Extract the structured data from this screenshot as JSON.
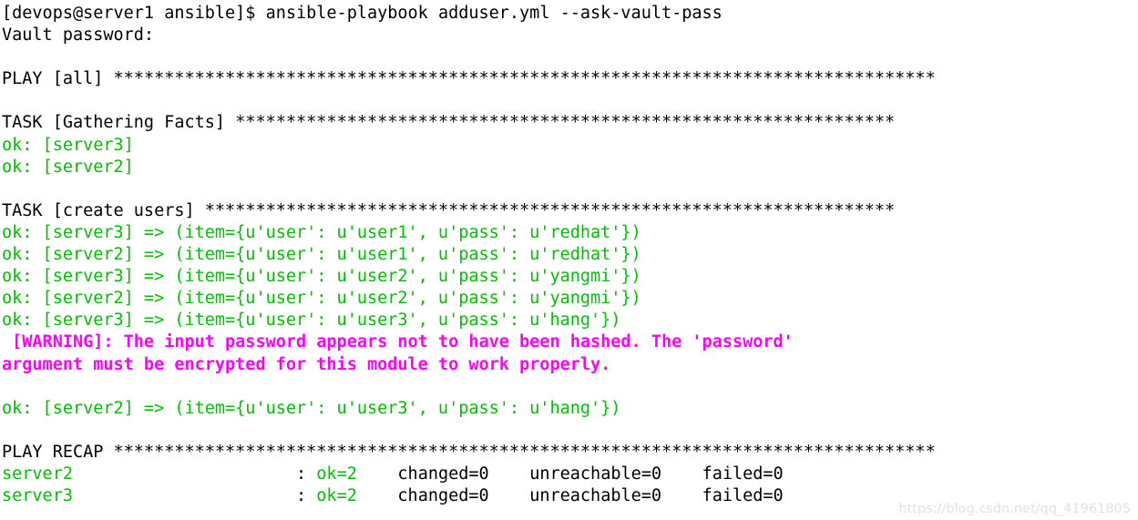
{
  "terminal": {
    "colors": {
      "background": "#ffffff",
      "default_text": "#000000",
      "ok_green": "#00c000",
      "warning_magenta": "#ff00ff",
      "watermark_grey": "#e2e2e2"
    },
    "prompt": "[devops@server1 ansible]$ ",
    "command": "ansible-playbook adduser.yml --ask-vault-pass",
    "vault_prompt": "Vault password:",
    "play_header": "PLAY [all] ",
    "play_header_stars": "*********************************************************************************",
    "task_gathering_label": "TASK [Gathering Facts] ",
    "task_gathering_stars": "*****************************************************************",
    "task_create_users_label": "TASK [create users] ",
    "task_create_users_stars": "********************************************************************",
    "recap_label": "PLAY RECAP ",
    "recap_stars": "*********************************************************************************",
    "gathering_results": [
      {
        "status": "ok: ",
        "host": "[server3]"
      },
      {
        "status": "ok: ",
        "host": "[server2]"
      }
    ],
    "create_users_results": [
      {
        "line": "ok: [server3] => (item={u'user': u'user1', u'pass': u'redhat'})"
      },
      {
        "line": "ok: [server2] => (item={u'user': u'user1', u'pass': u'redhat'})"
      },
      {
        "line": "ok: [server3] => (item={u'user': u'user2', u'pass': u'yangmi'})"
      },
      {
        "line": "ok: [server2] => (item={u'user': u'user2', u'pass': u'yangmi'})"
      },
      {
        "line": "ok: [server3] => (item={u'user': u'user3', u'pass': u'hang'})"
      }
    ],
    "warning": {
      "line1": " [WARNING]: The input password appears not to have been hashed. The 'password'",
      "line2": "argument must be encrypted for this module to work properly."
    },
    "post_warning_result": "ok: [server2] => (item={u'user': u'user3', u'pass': u'hang'})",
    "recap_rows": [
      {
        "host": "server2",
        "host_pad": "                      ",
        "colon": ": ",
        "ok": "ok=2",
        "ok_pad": "    ",
        "changed": "changed=0",
        "changed_pad": "    ",
        "unreachable": "unreachable=0",
        "unreachable_pad": "    ",
        "failed": "failed=0"
      },
      {
        "host": "server3",
        "host_pad": "                      ",
        "colon": ": ",
        "ok": "ok=2",
        "ok_pad": "    ",
        "changed": "changed=0",
        "changed_pad": "    ",
        "unreachable": "unreachable=0",
        "unreachable_pad": "    ",
        "failed": "failed=0"
      }
    ],
    "watermark": "https://blog.csdn.net/qq_41961805"
  }
}
